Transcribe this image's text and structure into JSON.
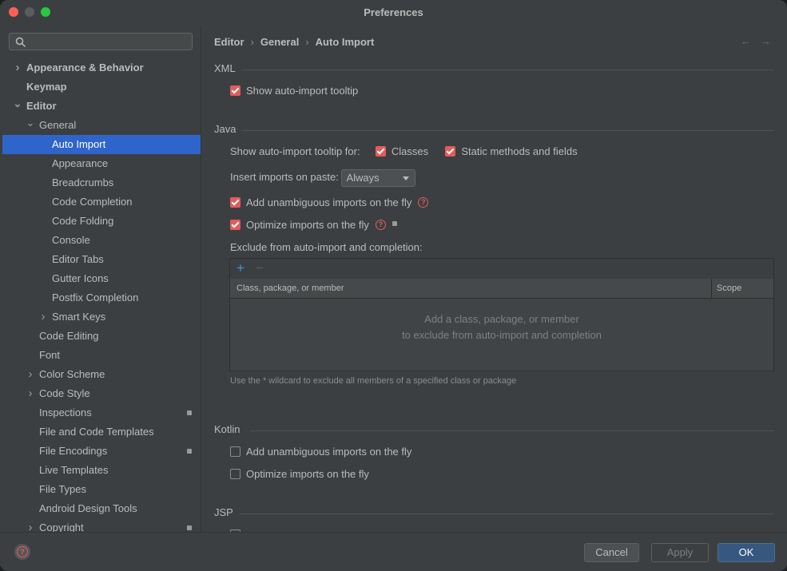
{
  "window": {
    "title": "Preferences"
  },
  "sidebar": {
    "search_placeholder": "",
    "items": [
      {
        "label": "Appearance & Behavior",
        "level": 0,
        "chevron": "right",
        "bold": true
      },
      {
        "label": "Keymap",
        "level": 0,
        "chevron": "",
        "bold": true
      },
      {
        "label": "Editor",
        "level": 0,
        "chevron": "down",
        "bold": true
      },
      {
        "label": "General",
        "level": 1,
        "chevron": "down"
      },
      {
        "label": "Auto Import",
        "level": 2,
        "chevron": "",
        "selected": true
      },
      {
        "label": "Appearance",
        "level": 2,
        "chevron": ""
      },
      {
        "label": "Breadcrumbs",
        "level": 2,
        "chevron": ""
      },
      {
        "label": "Code Completion",
        "level": 2,
        "chevron": ""
      },
      {
        "label": "Code Folding",
        "level": 2,
        "chevron": ""
      },
      {
        "label": "Console",
        "level": 2,
        "chevron": ""
      },
      {
        "label": "Editor Tabs",
        "level": 2,
        "chevron": ""
      },
      {
        "label": "Gutter Icons",
        "level": 2,
        "chevron": ""
      },
      {
        "label": "Postfix Completion",
        "level": 2,
        "chevron": ""
      },
      {
        "label": "Smart Keys",
        "level": 2,
        "chevron": "right"
      },
      {
        "label": "Code Editing",
        "level": 1,
        "chevron": ""
      },
      {
        "label": "Font",
        "level": 1,
        "chevron": ""
      },
      {
        "label": "Color Scheme",
        "level": 1,
        "chevron": "right"
      },
      {
        "label": "Code Style",
        "level": 1,
        "chevron": "right"
      },
      {
        "label": "Inspections",
        "level": 1,
        "chevron": "",
        "badge": true
      },
      {
        "label": "File and Code Templates",
        "level": 1,
        "chevron": ""
      },
      {
        "label": "File Encodings",
        "level": 1,
        "chevron": "",
        "badge": true
      },
      {
        "label": "Live Templates",
        "level": 1,
        "chevron": ""
      },
      {
        "label": "File Types",
        "level": 1,
        "chevron": ""
      },
      {
        "label": "Android Design Tools",
        "level": 1,
        "chevron": ""
      },
      {
        "label": "Copyright",
        "level": 1,
        "chevron": "right",
        "badge": true
      }
    ]
  },
  "breadcrumb": {
    "items": [
      "Editor",
      "General",
      "Auto Import"
    ],
    "back_icon": "arrow-left-icon",
    "forward_icon": "arrow-right-icon"
  },
  "xml": {
    "title": "XML",
    "show_tooltip": {
      "label": "Show auto-import tooltip",
      "checked": true
    }
  },
  "java": {
    "title": "Java",
    "tooltip_for_label": "Show auto-import tooltip for:",
    "classes": {
      "label": "Classes",
      "checked": true
    },
    "static_methods": {
      "label": "Static methods and fields",
      "checked": true
    },
    "insert_on_paste_label": "Insert imports on paste:",
    "insert_on_paste_value": "Always",
    "add_unambiguous": {
      "label": "Add unambiguous imports on the fly",
      "checked": true
    },
    "optimize_imports": {
      "label": "Optimize imports on the fly",
      "checked": true
    },
    "exclude_label": "Exclude from auto-import and completion:",
    "table": {
      "col_class": "Class, package, or member",
      "col_scope": "Scope",
      "empty_line1": "Add a class, package, or member",
      "empty_line2": "to exclude from auto-import and completion"
    },
    "hint": "Use the * wildcard to exclude all members of a specified class or package"
  },
  "kotlin": {
    "title": "Kotlin",
    "add_unambiguous": {
      "label": "Add unambiguous imports on the fly",
      "checked": false
    },
    "optimize_imports": {
      "label": "Optimize imports on the fly",
      "checked": false
    }
  },
  "jsp": {
    "title": "JSP"
  },
  "footer": {
    "cancel": "Cancel",
    "apply": "Apply",
    "ok": "OK"
  },
  "colors": {
    "accent_selection": "#2f65ca",
    "checkbox_checked": "#e25c5c",
    "ok_button": "#365880"
  }
}
